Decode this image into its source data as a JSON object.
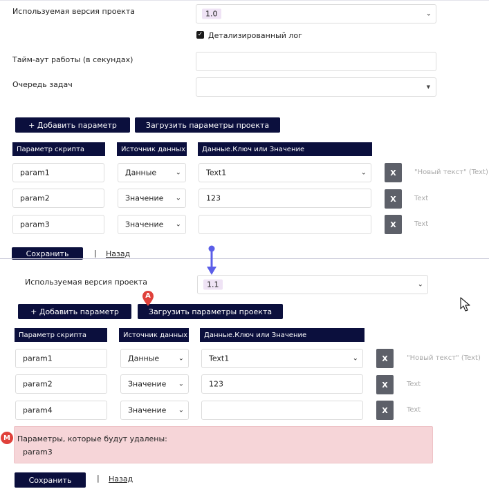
{
  "top": {
    "version_label": "Используемая версия проекта",
    "version_value": "1.0",
    "detailed_log_label": "Детализированный лог",
    "timeout_label": "Тайм-аут работы (в секундах)",
    "timeout_value": "",
    "queue_label": "Очередь задач",
    "queue_value": "",
    "add_param_button": "+ Добавить параметр",
    "load_params_button": "Загрузить параметры проекта",
    "headers": [
      "Параметр скрипта",
      "Источник данных",
      "Данные.Ключ или Значение"
    ],
    "rows": [
      {
        "param": "param1",
        "source": "Данные",
        "value": "Text1",
        "hint": "\"Новый текст\" (Text)"
      },
      {
        "param": "param2",
        "source": "Значение",
        "value": "123",
        "hint": "Text"
      },
      {
        "param": "param3",
        "source": "Значение",
        "value": "",
        "hint": "Text"
      }
    ],
    "remove_label": "X",
    "save_button": "Сохранить",
    "separator": "|",
    "back_link": "Назад"
  },
  "bottom": {
    "version_label": "Используемая версия проекта",
    "version_value": "1.1",
    "add_param_button": "+ Добавить параметр",
    "load_params_button": "Загрузить параметры проекта",
    "marker_a": "A",
    "headers": [
      "Параметр скрипта",
      "Источник данных",
      "Данные.Ключ или Значение"
    ],
    "rows": [
      {
        "param": "param1",
        "source": "Данные",
        "value": "Text1",
        "hint": "\"Новый текст\" (Text)"
      },
      {
        "param": "param2",
        "source": "Значение",
        "value": "123",
        "hint": "Text"
      },
      {
        "param": "param4",
        "source": "Значение",
        "value": "",
        "hint": "Text"
      }
    ],
    "remove_label": "X",
    "alert_marker": "M",
    "alert_title": "Параметры, которые будут удалены:",
    "alert_item": "param3",
    "save_button": "Сохранить",
    "separator": "|",
    "back_link": "Назад"
  },
  "colors": {
    "navy": "#0b0f3d",
    "remove_button": "#5d6069",
    "alert_bg": "#f6d5d8",
    "marker": "#e0413b",
    "arrow": "#5b5ee8",
    "badge_bg": "#efe3f5"
  },
  "icons": {
    "dropdown": "chevron-down-icon",
    "checkbox": "checkbox-checked-icon",
    "cursor": "mouse-cursor-icon",
    "arrow": "arrow-down-icon"
  }
}
